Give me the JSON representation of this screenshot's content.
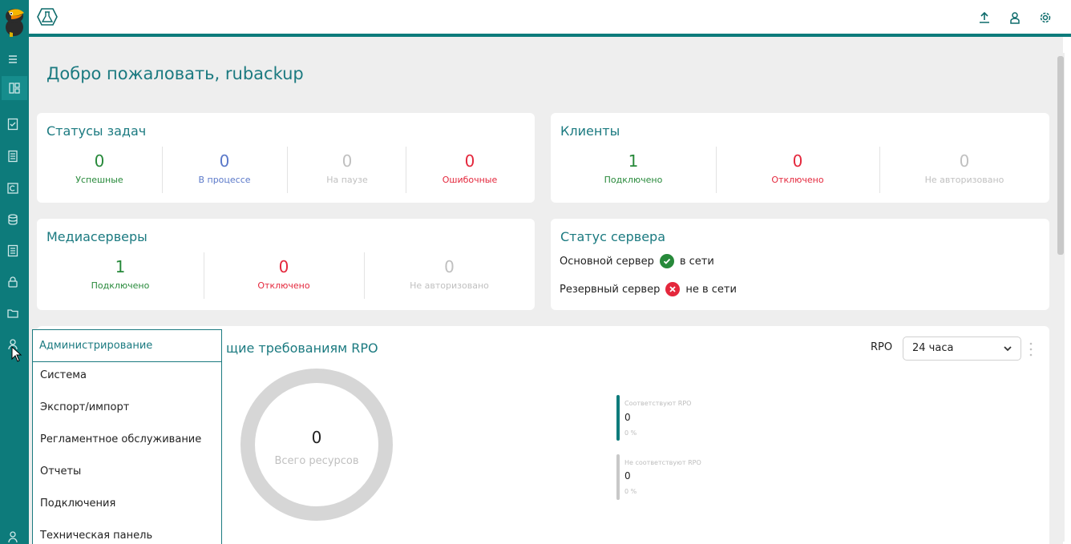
{
  "header": {
    "welcome": "Добро пожаловать, rubackup"
  },
  "task_status": {
    "title": "Статусы задач",
    "stats": [
      {
        "value": "0",
        "label": "Успешные",
        "color": "#27893a"
      },
      {
        "value": "0",
        "label": "В процессе",
        "color": "#5a78c9"
      },
      {
        "value": "0",
        "label": "На паузе",
        "color": "#c0c0c0"
      },
      {
        "value": "0",
        "label": "Ошибочные",
        "color": "#e4273c"
      }
    ]
  },
  "clients": {
    "title": "Клиенты",
    "stats": [
      {
        "value": "1",
        "label": "Подключено",
        "color": "#27893a"
      },
      {
        "value": "0",
        "label": "Отключено",
        "color": "#e4273c"
      },
      {
        "value": "0",
        "label": "Не авторизовано",
        "color": "#c0c0c0"
      }
    ]
  },
  "media_servers": {
    "title": "Медиасерверы",
    "stats": [
      {
        "value": "1",
        "label": "Подключено",
        "color": "#27893a"
      },
      {
        "value": "0",
        "label": "Отключено",
        "color": "#e4273c"
      },
      {
        "value": "0",
        "label": "Не авторизовано",
        "color": "#c0c0c0"
      }
    ]
  },
  "server_status": {
    "title": "Статус сервера",
    "primary": {
      "label": "Основной сервер",
      "status": "в сети",
      "icon": "check-circle-icon",
      "color": "#27893a"
    },
    "backup": {
      "label": "Резервный сервер",
      "status": "не в сети",
      "icon": "cross-circle-icon",
      "color": "#e4273c"
    }
  },
  "rpo": {
    "title": "щие требованиям RPO",
    "select_label": "RPO",
    "select_value": "24 часа",
    "total_value": "0",
    "total_label": "Всего ресурсов",
    "legend": [
      {
        "title": "Соответствуют RPO",
        "value": "0",
        "percent": "0 %",
        "color": "#0d7b7b"
      },
      {
        "title": "Не соответствуют RPO",
        "value": "0",
        "percent": "0 %",
        "color": "#c8c8c8"
      }
    ]
  },
  "menu": {
    "header": "Администрирование",
    "items": [
      "Система",
      "Экспорт/импорт",
      "Регламентное обслуживание",
      "Отчеты",
      "Подключения",
      "Техническая панель"
    ]
  },
  "icons": {
    "rail": [
      "menu-icon",
      "dashboard-icon",
      "tasks-icon",
      "documents-icon",
      "clients-icon",
      "storage-icon",
      "journal-icon",
      "security-icon",
      "folder-icon",
      "administration-icon",
      "user-icon"
    ],
    "top": [
      "upload-icon",
      "user-icon",
      "settings-icon"
    ]
  }
}
